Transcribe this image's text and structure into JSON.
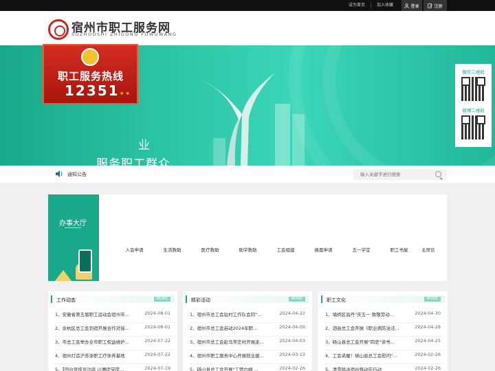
{
  "topbar": {
    "links": [
      "设为首页",
      "加入收藏"
    ],
    "login": "登录",
    "register": "注册"
  },
  "header": {
    "title": "宿州市职工服务网",
    "subtitle": "SUZHOUSHI ZHIGONG FUWUWANG"
  },
  "banner": {
    "hotline_title": "职工服务热线",
    "hotline_number": "12351",
    "slogan_partial": "业",
    "slogan": "服务职工群众"
  },
  "qr": {
    "wechat_label": "微信二维码",
    "weibo_label": "微博二维码"
  },
  "notice": {
    "label": "通知公告",
    "search_placeholder": "输入关键字进行搜索"
  },
  "service": {
    "title": "办事大厅",
    "items": [
      "入会申请",
      "生活救助",
      "医疗救助",
      "助学救助",
      "工会组建",
      "换届申请",
      "五一学堂",
      "职工书屋",
      "主席信"
    ]
  },
  "panels": [
    {
      "title": "工作动态",
      "more": "MORE",
      "items": [
        {
          "text": "1、安徽省第五届职工运动会宿州市...",
          "date": "2024-08-01"
        },
        {
          "text": "2、余杭区总工会到宿开展合作对接...",
          "date": "2024-08-01"
        },
        {
          "text": "3、市总工会举办全市职工权益维护...",
          "date": "2024-07-22"
        },
        {
          "text": "4、宿州打造沪苏浙职工疗休养基地",
          "date": "2024-07-22"
        },
        {
          "text": "5、【回台竞技显功底 以赛促学提...",
          "date": "2024-07-19"
        }
      ]
    },
    {
      "title": "精彩活动",
      "more": "MORE",
      "items": [
        {
          "text": "1、宿州市总工会驻村工作队会同\"...",
          "date": "2024-04-22"
        },
        {
          "text": "2、宿州市总工会启动2024年职...",
          "date": "2024-04-09"
        },
        {
          "text": "3、宿州市总工会赴马常庄村开展走...",
          "date": "2024-04-03"
        },
        {
          "text": "4、宿州市职工服务中心开展就业援...",
          "date": "2024-03-13"
        },
        {
          "text": "5、砀山县总工会开展\"工赞巾帼 ...",
          "date": "2024-02-26"
        }
      ]
    },
    {
      "title": "职工文化",
      "more": "MORE",
      "items": [
        {
          "text": "1、埇桥区昌丹\"庆五一 致敬劳动...",
          "date": "2024-04-30"
        },
        {
          "text": "2、泗县总工会开展《职业病防治法...",
          "date": "2024-04-28"
        },
        {
          "text": "3、砀山县总工会开展\"四史\"读书...",
          "date": "2024-04-25"
        },
        {
          "text": "4、工会诺履！砀山县总工会慰问\"...",
          "date": "2024-02-26"
        },
        {
          "text": "5、清雪除冰宿州移动在行动",
          "date": "2024-02-26"
        }
      ]
    }
  ],
  "colors": {
    "accent": "#1aa88a",
    "hotline_red": "#c8261e",
    "topbar": "#111111"
  }
}
